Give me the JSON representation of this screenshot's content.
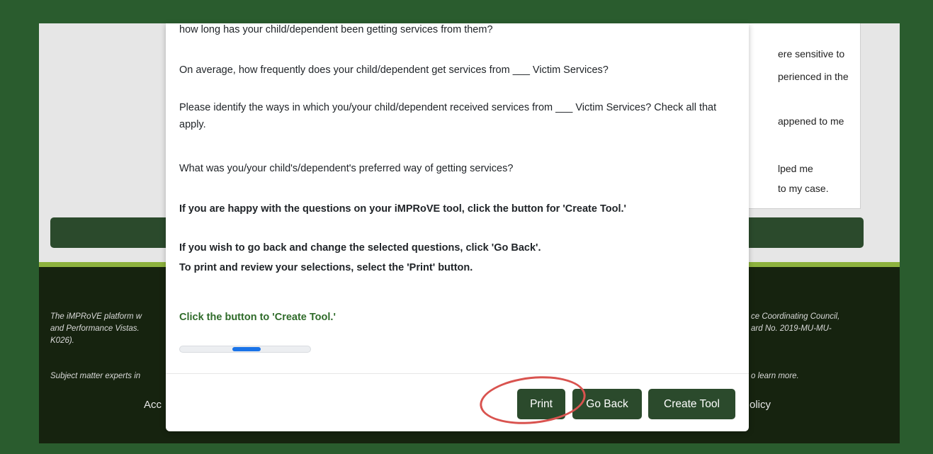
{
  "background_card": {
    "lines": [
      "ere sensitive to",
      "perienced in the",
      "appened to me",
      "lped me",
      "to my case."
    ]
  },
  "footer": {
    "para1_line1": "The iMPRoVE platform w",
    "para1_line2": "and Performance Vistas.",
    "para1_line3": "K026).",
    "para1_right_line1": "ce Coordinating Council,",
    "para1_right_line2": "ard No. 2019-MU-MU-",
    "para2_left": "Subject matter experts in",
    "para2_right": "o learn more.",
    "link_left": "Acc",
    "link_right": "olicy"
  },
  "modal": {
    "questions": [
      "how long has your child/dependent been getting services from them?",
      "On average, how frequently does your child/dependent get services from ___ Victim Services?",
      "Please identify the ways in which you/your child/dependent received services from ___ Victim Services? Check all that apply.",
      "What was you/your child's/dependent's preferred way of getting services?"
    ],
    "instruction_create": "If you are happy with the questions on your iMPRoVE tool, click the button for 'Create Tool.'",
    "instruction_back": "If you wish to go back and change the selected questions, click 'Go Back'.",
    "instruction_print": "To print and review your selections, select the 'Print' button.",
    "cta": "Click the button to 'Create Tool.'",
    "print_label": "Print",
    "go_back_label": "Go Back",
    "create_label": "Create Tool"
  },
  "colors": {
    "frame": "#2a5c2e",
    "button": "#2b4a2c",
    "cta_text": "#2f6b2a",
    "footer_bg": "#16230f",
    "footer_accent": "#8db23e",
    "annotation": "#d9534f",
    "progress": "#1a73e8"
  }
}
